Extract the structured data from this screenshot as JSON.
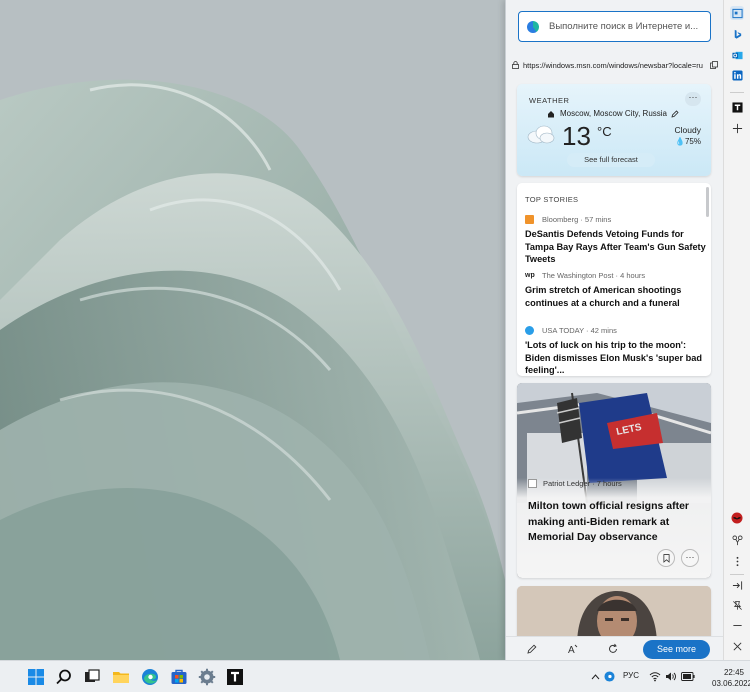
{
  "sidebar": {
    "search": {
      "placeholder": "Выполните поиск в Интернете и..."
    },
    "url": "https://windows.msn.com/windows/newsbar?locale=ru",
    "weather": {
      "title": "WEATHER",
      "more_label": "···",
      "location": "Moscow, Moscow City, Russia",
      "temperature": "13",
      "unit": "°C",
      "condition": "Cloudy",
      "humidity": "75%",
      "forecast_label": "See full forecast"
    },
    "top_stories": {
      "title": "TOP STORIES",
      "items": [
        {
          "source": "Bloomberg · 57 mins",
          "headline": "DeSantis Defends Vetoing Funds for Tampa Bay Rays After Team's Gun Safety Tweets",
          "logo_color": "#f0932b"
        },
        {
          "source": "The Washington Post · 4 hours",
          "headline": "Grim stretch of American shootings continues at a church and a funeral",
          "logo_color": "#222222"
        },
        {
          "source": "USA TODAY · 42 mins",
          "headline": "'Lots of luck on his trip to the moon': Biden dismisses Elon Musk's 'super bad feeling'...",
          "logo_color": "#2a9ee8"
        }
      ]
    },
    "feature": {
      "source": "Patriot Ledger · 7 hours",
      "headline": "Milton town official resigns after making anti-Biden remark at Memorial Day observance",
      "save_label": "🔖",
      "more_label": "···"
    },
    "bottom": {
      "see_more_label": "See more"
    }
  },
  "taskbar": {
    "language": "РУС",
    "time": "22:45",
    "date": "03.06.2022"
  },
  "colors": {
    "accent": "#1a73c7"
  }
}
